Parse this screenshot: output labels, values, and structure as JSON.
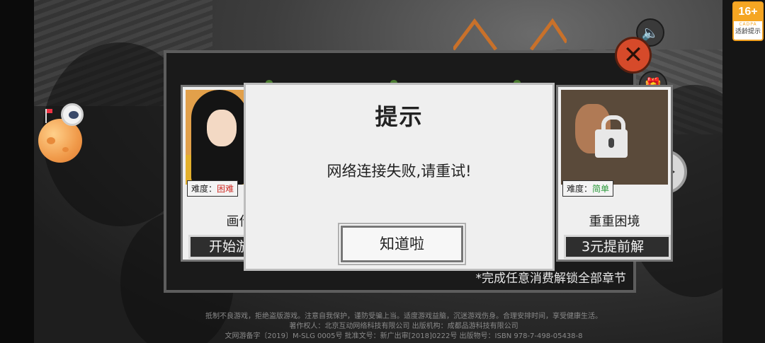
{
  "age_rating": {
    "number": "16+",
    "org": "CADPA",
    "label": "适龄提示"
  },
  "side_icons": {
    "sound": "speaker-icon",
    "gift": "gift-icon",
    "shop": "cart-icon",
    "play": "play-icon"
  },
  "panel": {
    "close_icon": "close-icon",
    "cards": [
      {
        "difficulty_label": "难度：",
        "difficulty_value": "困难",
        "difficulty_color": "#d0302a",
        "title": "画作",
        "action": "开始游"
      },
      {
        "difficulty_label": "难度：",
        "difficulty_value": "简单",
        "difficulty_color": "#2a9a3a",
        "title": "重重困境",
        "action": "3元提前解",
        "locked": true
      }
    ],
    "note": "*完成任意消费解锁全部章节"
  },
  "dialog": {
    "title": "提示",
    "message": "网络连接失败,请重试!",
    "button": "知道啦"
  },
  "footer": {
    "line1": "抵制不良游戏，拒绝盗版游戏。注意自我保护，谨防受骗上当。适度游戏益脑，沉迷游戏伤身。合理安排时间，享受健康生活。",
    "line2": "著作权人：北京互动网络科技有限公司 出版机构：成都品游科技有限公司",
    "line3": "文网游备字〔2019〕M-SLG 0005号 批准文号：新广出审[2018]0222号 出版物号：ISBN 978-7-498-05438-8"
  }
}
